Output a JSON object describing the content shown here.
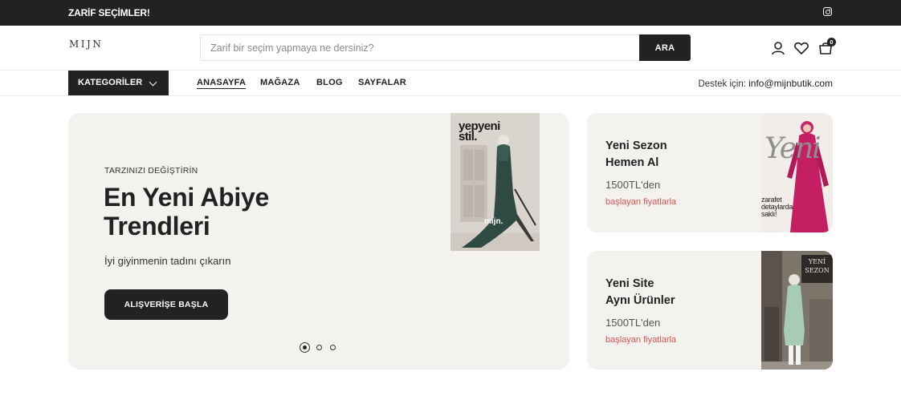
{
  "topbar": {
    "promo": "ZARİF SEÇİMLER!",
    "social_icon": "instagram-icon"
  },
  "header": {
    "logo": "MIJN",
    "search": {
      "placeholder": "Zarif bir seçim yapmaya ne dersiniz?",
      "button": "ARA"
    },
    "icons": [
      "user-icon",
      "heart-icon",
      "bag-icon"
    ],
    "cart_count": "0"
  },
  "nav": {
    "categories": "KATEGORİLER",
    "items": [
      {
        "label": "ANASAYFA",
        "active": true
      },
      {
        "label": "MAĞAZA"
      },
      {
        "label": "BLOG"
      },
      {
        "label": "SAYFALAR"
      }
    ],
    "support_label": "Destek için:",
    "support_email": "info@mijnbutik.com"
  },
  "hero": {
    "eyebrow": "TARZINIZI DEĞİŞTİRİN",
    "headline_line1": "En Yeni Abiye",
    "headline_line2": "Trendleri",
    "subtitle": "İyi giyinmenin tadını çıkarın",
    "cta": "ALIŞVERİŞE BAŞLA",
    "poster_title_line1": "yepyeni",
    "poster_title_line2": "stil.",
    "poster_brand": "mijn.",
    "slides": 3,
    "active_slide": 1
  },
  "cards": [
    {
      "title_line1": "Yeni Sezon",
      "title_line2": "Hemen Al",
      "price": "1500TL'den",
      "note": "başlayan fiyatlarla",
      "image_script": "Yeni",
      "image_text_lines": [
        "zarafet",
        "detaylarda",
        "saklı!"
      ]
    },
    {
      "title_line1": "Yeni Site",
      "title_line2": "Aynı Ürünler",
      "price": "1500TL'den",
      "note": "başlayan fiyatlarla",
      "image_sign_line1": "YENİ",
      "image_sign_line2": "SEZON"
    }
  ],
  "colors": {
    "dark": "#222222",
    "panel": "#f4f2ef",
    "accent_red": "#d9534f"
  }
}
